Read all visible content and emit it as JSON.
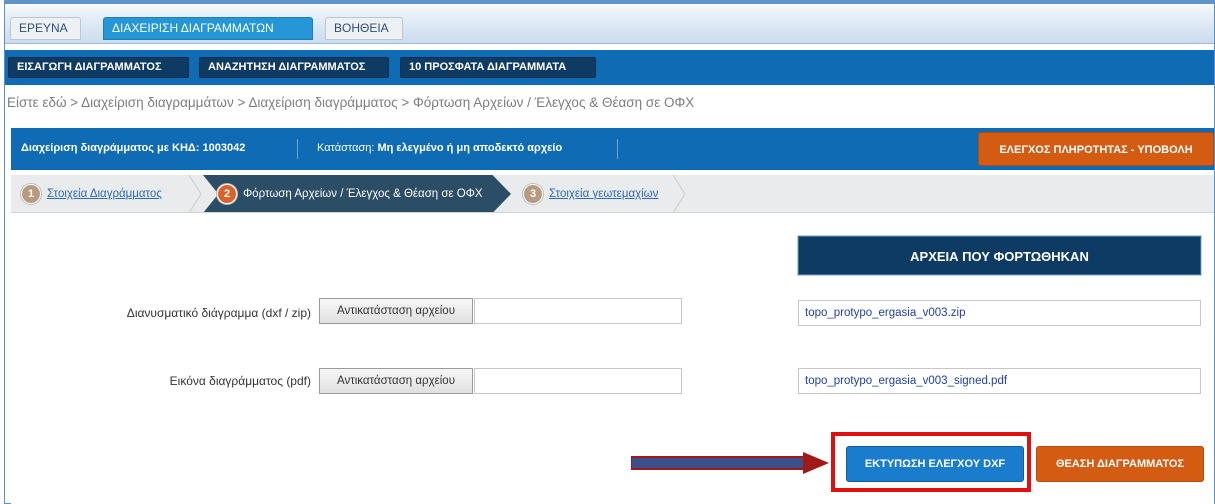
{
  "top_tabs": {
    "search": "ΕΡΕΥΝΑ",
    "manage": "ΔΙΑΧΕΙΡΙΣΗ ΔΙΑΓΡΑΜΜΑΤΩΝ",
    "help": "ΒΟΗΘΕΙΑ"
  },
  "menu": {
    "import": "ΕΙΣΑΓΩΓΗ ΔΙΑΓΡΑΜΜΑΤΟΣ",
    "search": "ΑΝΑΖΗΤΗΣΗ ΔΙΑΓΡΑΜΜΑΤΟΣ",
    "recent": "10 ΠΡΟΣΦΑΤΑ ΔΙΑΓΡΑΜΜΑΤΑ"
  },
  "breadcrumb": "Είστε εδώ > Διαχείριση διαγραμμάτων > Διαχείριση διαγράμματος > Φόρτωση Αρχείων / Έλεγχος & Θέαση σε ΟΦΧ",
  "info": {
    "title": "Διαχείριση διαγράμματος με ΚΗΔ: 1003042",
    "status_label": "Κατάσταση:",
    "status_value": "Μη ελεγμένο ή μη αποδεκτό αρχείο",
    "submit_button": "ΕΛΕΓΧΟΣ ΠΛΗΡΟΤΗΤΑΣ - ΥΠΟΒΟΛΗ"
  },
  "steps": [
    {
      "num": "1",
      "label": "Στοιχεία Διαγράμματος"
    },
    {
      "num": "2",
      "label": "Φόρτωση Αρχείων / Έλεγχος & Θέαση σε ΟΦΧ"
    },
    {
      "num": "3",
      "label": "Στοιχεία γεωτεμαχίων"
    }
  ],
  "files": {
    "header": "ΑΡΧΕΙΑ ΠΟΥ ΦΟΡΤΩΘΗΚΑΝ",
    "rows": [
      {
        "label": "Διανυσματικό διάγραμμα (dxf / zip)",
        "button": "Αντικατάσταση αρχείου",
        "uploaded": "topo_protypo_ergasia_v003.zip"
      },
      {
        "label": "Εικόνα διαγράμματος (pdf)",
        "button": "Αντικατάσταση αρχείου",
        "uploaded": "topo_protypo_ergasia_v003_signed.pdf"
      }
    ]
  },
  "actions": {
    "print_dxf": "ΕΚΤΥΠΩΣΗ ΕΛΕΓΧΟΥ DXF",
    "view_diagram": "ΘΕΑΣΗ ΔΙΑΓΡΑΜΜΑΤΟΣ"
  },
  "colors": {
    "menu_blue": "#0f6bb3",
    "dark_navy": "#0e3b63",
    "orange": "#d45c12",
    "highlight_red": "#e01010"
  }
}
